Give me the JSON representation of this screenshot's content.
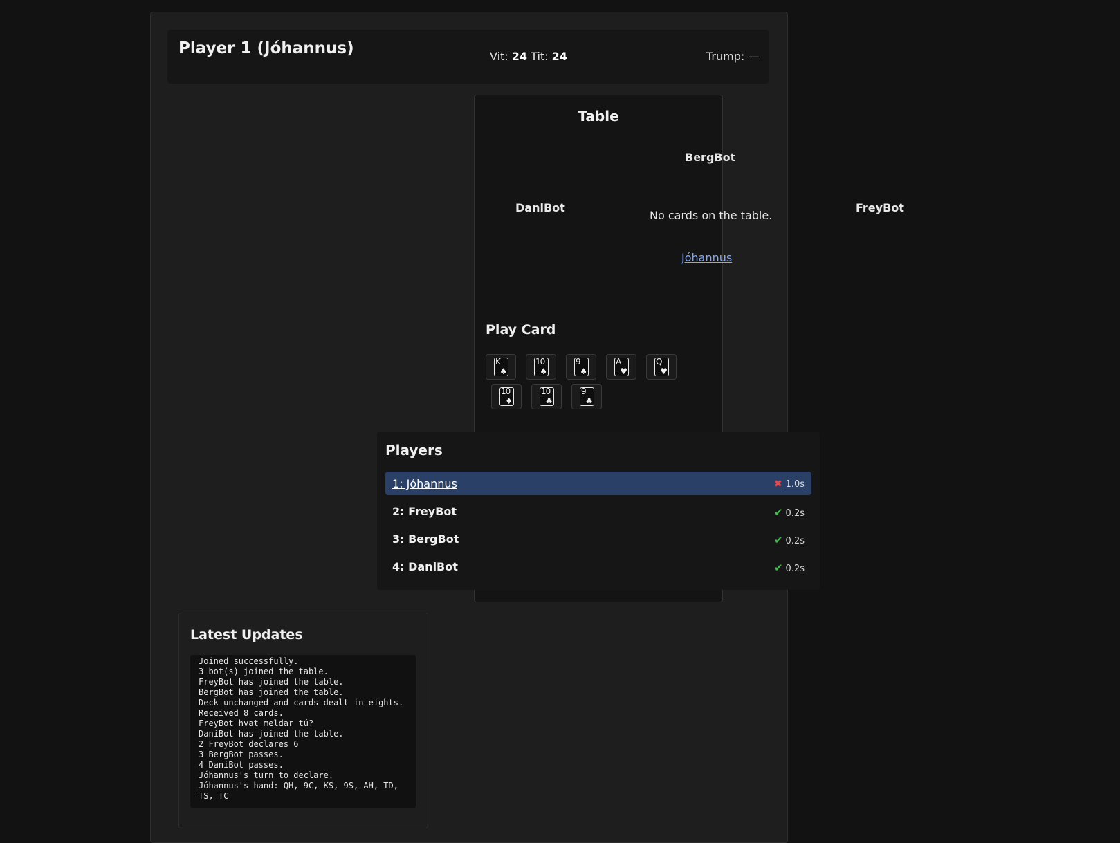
{
  "header": {
    "title": "Player 1 (Jóhannus)",
    "vit_label": "Vit:",
    "vit_value": "24",
    "tit_label": "Tit:",
    "tit_value": "24",
    "trump": "Trump: —"
  },
  "table": {
    "title": "Table",
    "seat_top": "BergBot",
    "seat_left": "DaniBot",
    "seat_right": "FreyBot",
    "seat_bottom": "Jóhannus",
    "empty_message": "No cards on the table."
  },
  "hand": {
    "title": "Play Card",
    "cards": [
      {
        "rank": "K",
        "suit": "♠"
      },
      {
        "rank": "10",
        "suit": "♠"
      },
      {
        "rank": "9",
        "suit": "♠"
      },
      {
        "rank": "A",
        "suit": "♥"
      },
      {
        "rank": "Q",
        "suit": "♥"
      },
      {
        "rank": "10",
        "suit": "♦"
      },
      {
        "rank": "10",
        "suit": "♣"
      },
      {
        "rank": "9",
        "suit": "♣"
      }
    ]
  },
  "players": {
    "title": "Players",
    "rows": [
      {
        "name": "1: Jóhannus",
        "status_icon": "cross-icon",
        "time": "1.0s",
        "active": true
      },
      {
        "name": "2: FreyBot",
        "status_icon": "check-icon",
        "time": "0.2s",
        "active": false
      },
      {
        "name": "3: BergBot",
        "status_icon": "check-icon",
        "time": "0.2s",
        "active": false
      },
      {
        "name": "4: DaniBot",
        "status_icon": "check-icon",
        "time": "0.2s",
        "active": false
      }
    ]
  },
  "updates": {
    "title": "Latest Updates",
    "lines": [
      "Joined successfully.",
      "3 bot(s) joined the table.",
      "FreyBot has joined the table.",
      "BergBot has joined the table.",
      "Deck unchanged and cards dealt in eights.",
      "Received 8 cards.",
      "FreyBot hvat meldar tú?",
      "DaniBot has joined the table.",
      "2 FreyBot declares 6",
      "3 BergBot passes.",
      "4 DaniBot passes.",
      "Jóhannus's turn to declare.",
      "Jóhannus's hand: QH, 9C, KS, 9S, AH, TD, TS, TC"
    ]
  },
  "colors": {
    "background": "#121212",
    "active_row": "#2a4066",
    "link": "#7fa8ff",
    "ok": "#3fbf4f",
    "error": "#e5484d"
  }
}
